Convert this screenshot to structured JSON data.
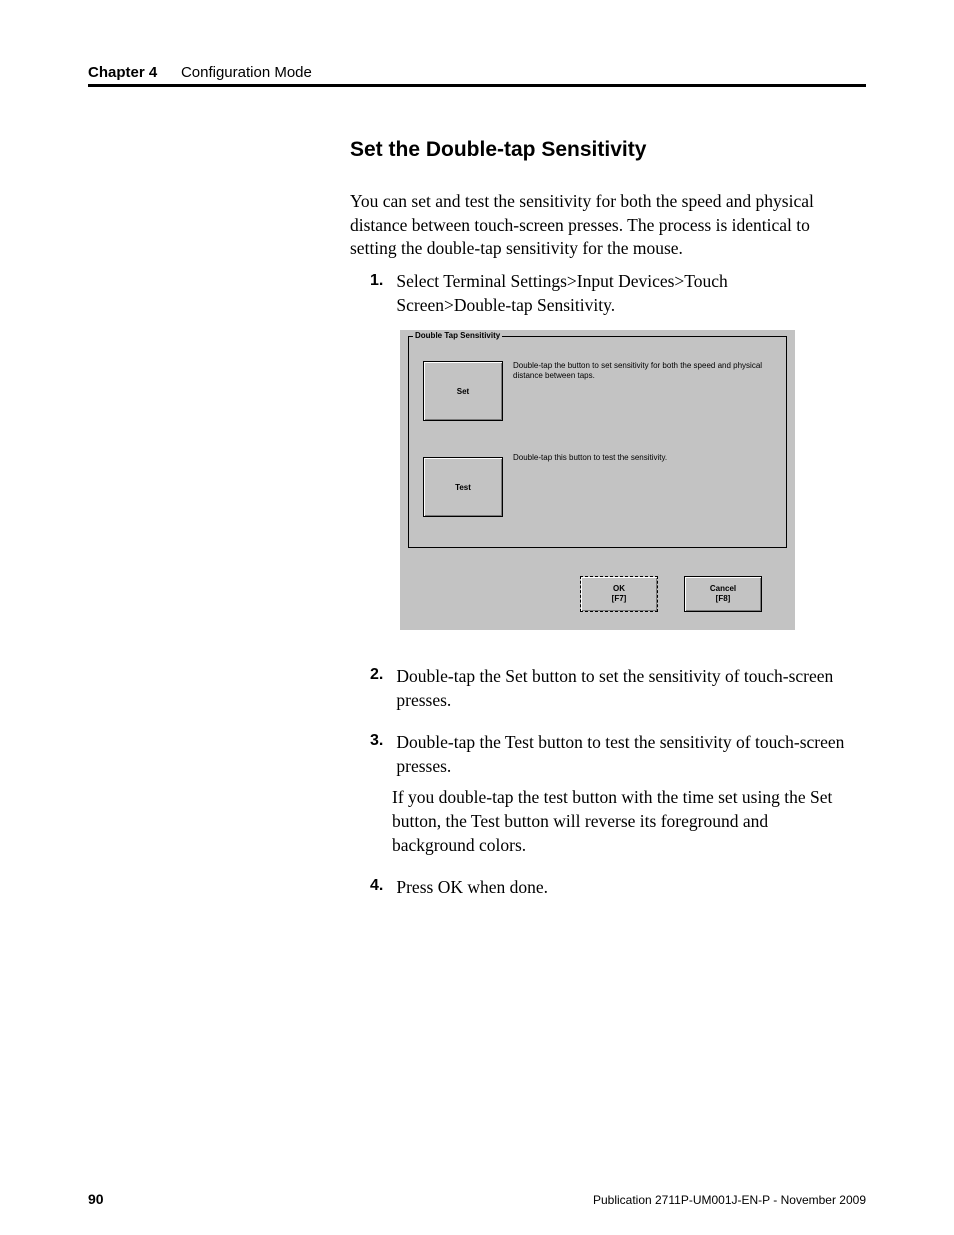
{
  "header": {
    "chapter": "Chapter 4",
    "section": "Configuration Mode"
  },
  "title": "Set the Double-tap Sensitivity",
  "intro": "You can set and test the sensitivity for both the speed and physical distance between touch-screen presses. The process is identical to setting the double-tap sensitivity for the mouse.",
  "steps": [
    {
      "n": "1.",
      "text": "Select Terminal Settings>Input Devices>Touch Screen>Double-tap Sensitivity."
    },
    {
      "n": "2.",
      "text": "Double-tap the Set button to set the sensitivity of touch-screen presses."
    },
    {
      "n": "3.",
      "text": "Double-tap the Test button to test the sensitivity of touch-screen presses.",
      "extra": "If you double-tap the test button with the time set using the Set button, the Test button will reverse its foreground and background colors."
    },
    {
      "n": "4.",
      "text": "Press OK when done."
    }
  ],
  "dialog": {
    "legend": "Double Tap Sensitivity",
    "set_button": "Set",
    "set_desc": "Double-tap the button to set sensitivity for both the speed and physical distance between taps.",
    "test_button": "Test",
    "test_desc": "Double-tap this button to test the sensitivity.",
    "ok_line1": "OK",
    "ok_line2": "[F7]",
    "cancel_line1": "Cancel",
    "cancel_line2": "[F8]"
  },
  "footer": {
    "page": "90",
    "pub": "Publication 2711P-UM001J-EN-P - November 2009"
  }
}
